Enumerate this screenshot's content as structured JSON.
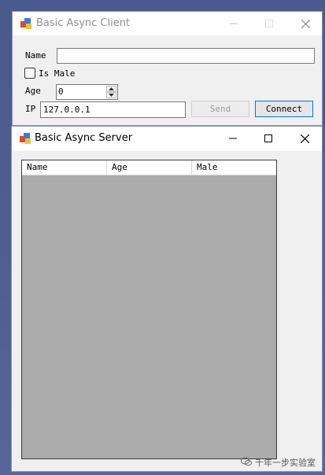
{
  "client": {
    "title": "Basic Async Client",
    "name_label": "Name",
    "name_value": "",
    "is_male_label": "Is Male",
    "is_male_checked": false,
    "age_label": "Age",
    "age_value": "0",
    "ip_label": "IP",
    "ip_value": "127.0.0.1",
    "send_label": "Send",
    "connect_label": "Connect"
  },
  "server": {
    "title": "Basic Async Server",
    "columns": [
      "Name",
      "Age",
      "Male"
    ]
  },
  "watermark": "千年一步实验室",
  "colors": {
    "listview_bg": "#ababab",
    "window_bg": "#f0f0f0",
    "desktop": "#4e5f92"
  },
  "icons": {
    "app": "app-icon",
    "minimize": "minimize-icon",
    "maximize": "maximize-icon",
    "close": "close-icon"
  }
}
